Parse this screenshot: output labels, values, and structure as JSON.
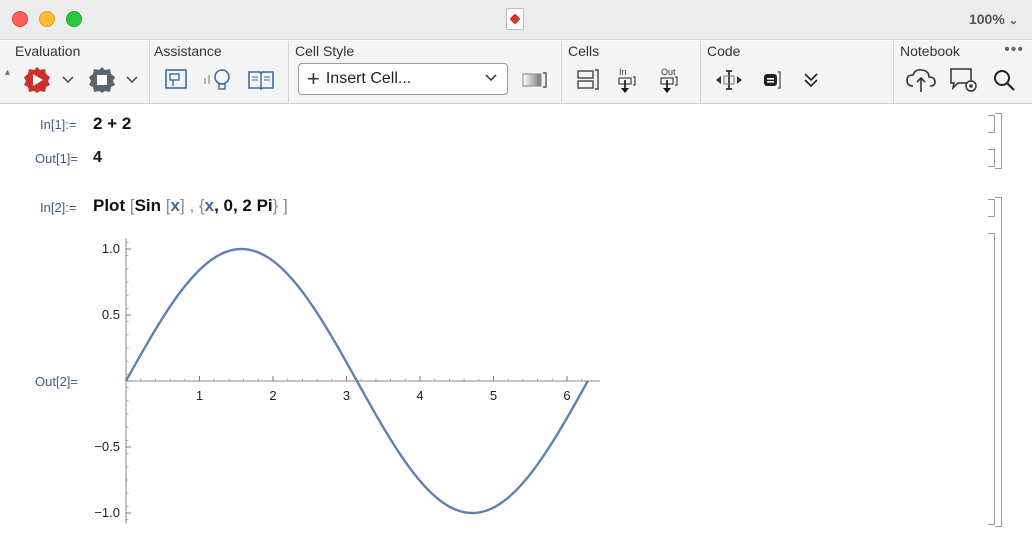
{
  "window": {
    "zoom": "100%"
  },
  "toolbar": {
    "evaluation": {
      "label": "Evaluation"
    },
    "assistance": {
      "label": "Assistance"
    },
    "cell_style": {
      "label": "Cell Style",
      "insert_cell": "Insert Cell..."
    },
    "cells": {
      "label": "Cells",
      "in_label": "In",
      "out_label": "Out"
    },
    "code": {
      "label": "Code"
    },
    "notebook": {
      "label": "Notebook"
    }
  },
  "cells": [
    {
      "in_label": "In[1]:=",
      "input": "2 + 2",
      "out_label": "Out[1]=",
      "output": "4"
    },
    {
      "in_label": "In[2]:=",
      "input_parts": [
        "Plot",
        "[",
        "Sin",
        "[",
        "x",
        "]",
        ",",
        "{",
        "x",
        ", 0, 2 Pi",
        "}",
        "]"
      ],
      "out_label": "Out[2]="
    }
  ],
  "chart_data": {
    "type": "line",
    "series": [
      {
        "function": "Sin[x]",
        "x_range": [
          0,
          6.283
        ],
        "color": "#5e81b5"
      }
    ],
    "x_ticks": [
      1,
      2,
      3,
      4,
      5,
      6
    ],
    "y_ticks": [
      -1.0,
      -0.5,
      0.5,
      1.0
    ],
    "x_tick_labels": [
      "1",
      "2",
      "3",
      "4",
      "5",
      "6"
    ],
    "y_tick_labels": [
      "−1.0",
      "−0.5",
      "0.5",
      "1.0"
    ],
    "xlim": [
      0,
      6.283
    ],
    "ylim": [
      -1,
      1
    ],
    "grid": false
  }
}
